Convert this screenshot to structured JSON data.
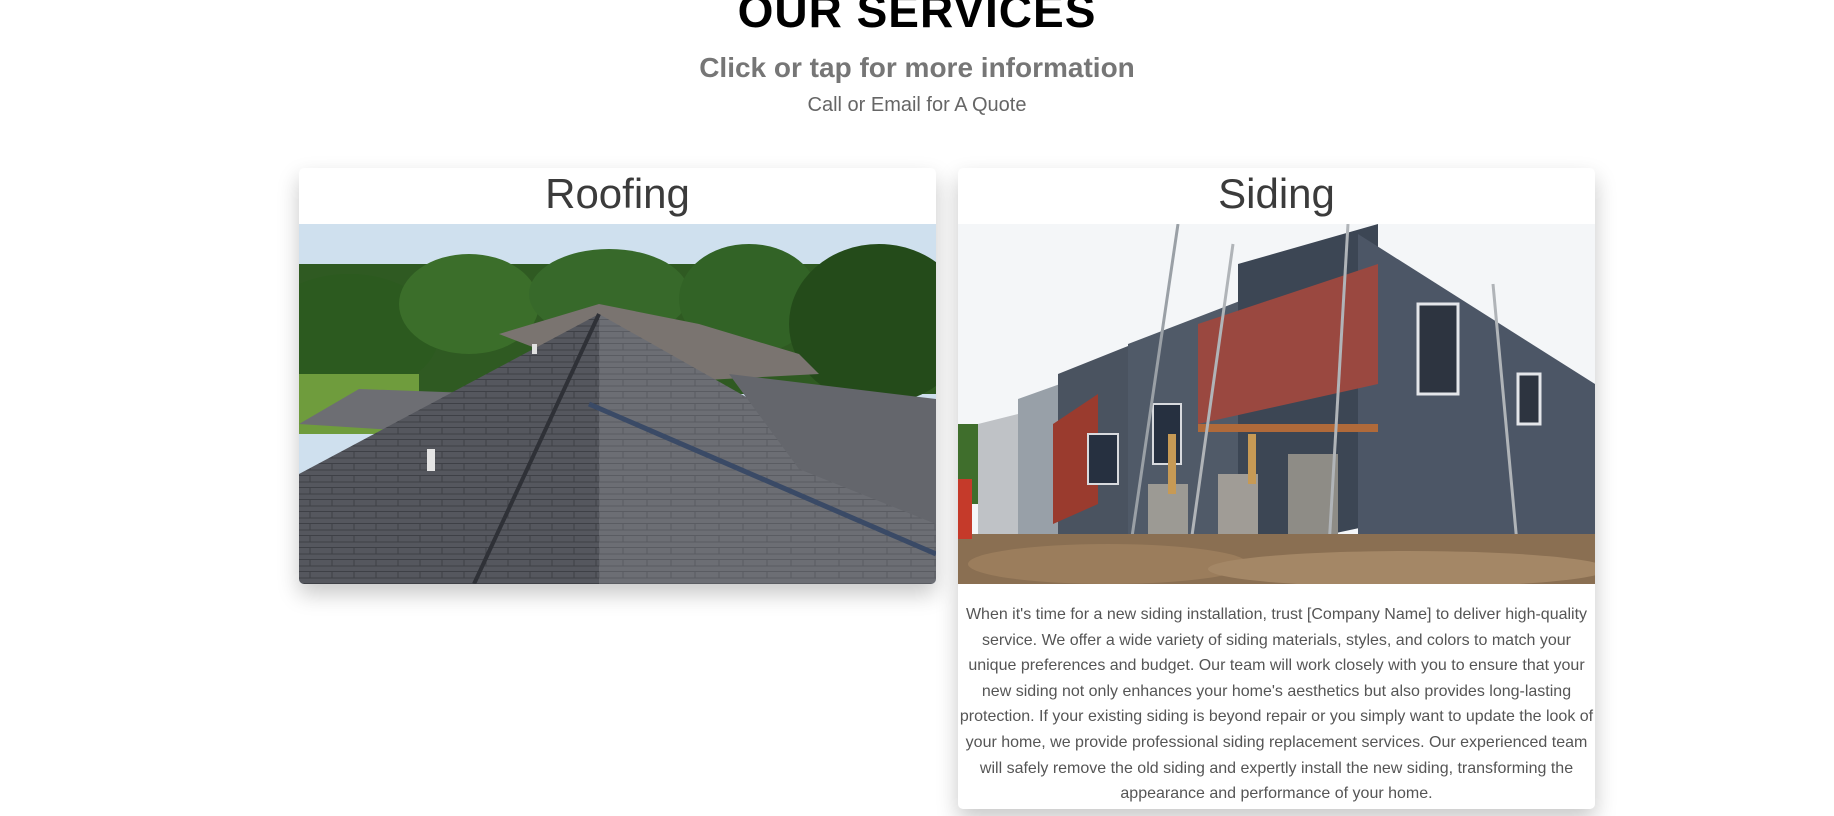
{
  "section": {
    "heading": "OUR SERVICES",
    "subheading": "Click or tap for more information",
    "quote_line": "Call or Email for A Quote"
  },
  "cards": [
    {
      "title": "Roofing",
      "image_icon": "roof-photo"
    },
    {
      "title": "Siding",
      "image_icon": "house-siding-photo",
      "description": "When it's time for a new siding installation, trust [Company Name] to deliver high-quality service. We offer a wide variety of siding materials, styles, and colors to match your unique preferences and budget. Our team will work closely with you to ensure that your new siding not only enhances your home's aesthetics but also provides long-lasting protection. If your existing siding is beyond repair or you simply want to update the look of your home, we provide professional siding replacement services. Our experienced team will safely remove the old siding and expertly install the new siding, transforming the appearance and performance of your home."
    }
  ],
  "colors": {
    "heading": "#000000",
    "subheading": "#767676",
    "body_text": "#555555",
    "card_bg": "#ffffff"
  }
}
